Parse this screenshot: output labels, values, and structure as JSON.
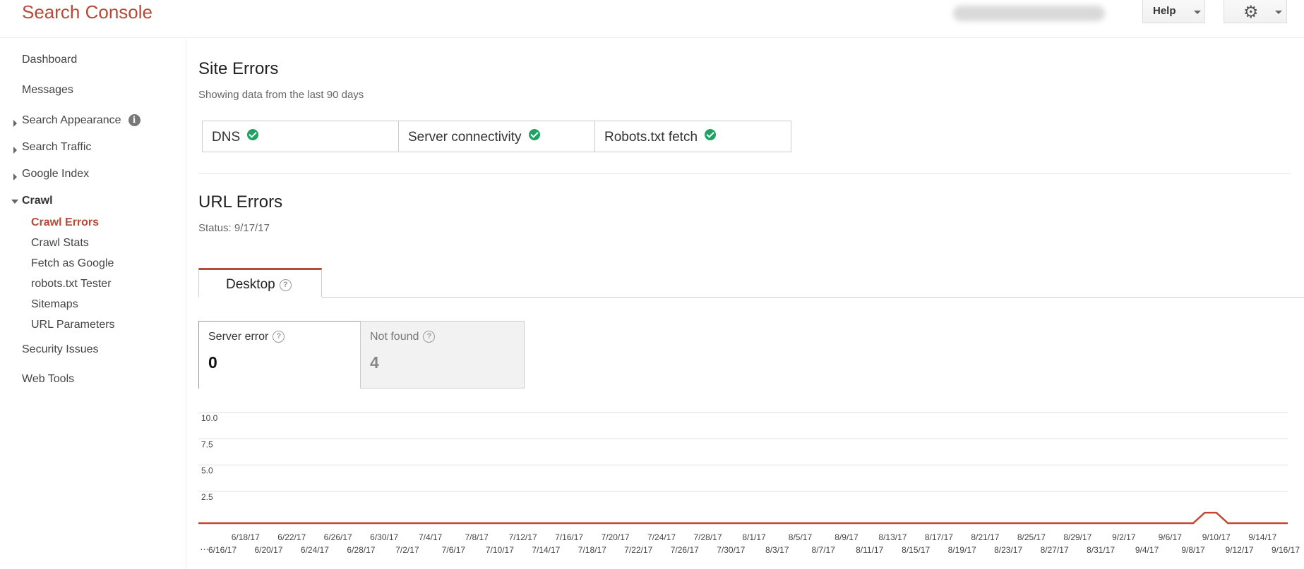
{
  "header": {
    "app_title": "Search Console",
    "help_label": "Help",
    "settings_icon": "gear-icon"
  },
  "sidebar": {
    "dashboard": "Dashboard",
    "messages": "Messages",
    "search_appearance": "Search Appearance",
    "search_traffic": "Search Traffic",
    "google_index": "Google Index",
    "crawl": "Crawl",
    "crawl_items": [
      "Crawl Errors",
      "Crawl Stats",
      "Fetch as Google",
      "robots.txt Tester",
      "Sitemaps",
      "URL Parameters"
    ],
    "security_issues": "Security Issues",
    "web_tools": "Web Tools"
  },
  "site_errors": {
    "title": "Site Errors",
    "subtitle": "Showing data from the last 90 days",
    "checks": [
      "DNS",
      "Server connectivity",
      "Robots.txt fetch"
    ]
  },
  "url_errors": {
    "title": "URL Errors",
    "status": "Status: 9/17/17",
    "tab": "Desktop",
    "metrics": [
      {
        "label": "Server error",
        "value": "0"
      },
      {
        "label": "Not found",
        "value": "4"
      }
    ]
  },
  "colors": {
    "brand": "#b44a38",
    "ok": "#1ea362",
    "line": "#c0462d"
  },
  "chart_data": {
    "type": "line",
    "ylim": [
      0,
      10
    ],
    "y_ticks": [
      "10.0",
      "7.5",
      "5.0",
      "2.5"
    ],
    "x_top_labels": [
      "6/18/17",
      "6/22/17",
      "6/26/17",
      "6/30/17",
      "7/4/17",
      "7/8/17",
      "7/12/17",
      "7/16/17",
      "7/20/17",
      "7/24/17",
      "7/28/17",
      "8/1/17",
      "8/5/17",
      "8/9/17",
      "8/13/17",
      "8/17/17",
      "8/21/17",
      "8/25/17",
      "8/29/17",
      "9/2/17",
      "9/6/17",
      "9/10/17",
      "9/14/17"
    ],
    "x_bottom_labels": [
      "6/16/17",
      "6/20/17",
      "6/24/17",
      "6/28/17",
      "7/2/17",
      "7/6/17",
      "7/10/17",
      "7/14/17",
      "7/18/17",
      "7/22/17",
      "7/26/17",
      "7/30/17",
      "8/3/17",
      "8/7/17",
      "8/11/17",
      "8/15/17",
      "8/19/17",
      "8/23/17",
      "8/27/17",
      "8/31/17",
      "9/4/17",
      "9/8/17",
      "9/12/17",
      "9/16/17"
    ],
    "series": [
      {
        "points": [
          {
            "date": "6/16/17",
            "value": 0
          },
          {
            "date": "9/8/17",
            "value": 0
          },
          {
            "date": "9/9/17",
            "value": 1
          },
          {
            "date": "9/10/17",
            "value": 1
          },
          {
            "date": "9/11/17",
            "value": 0
          },
          {
            "date": "9/16/17",
            "value": 0
          }
        ]
      }
    ]
  }
}
